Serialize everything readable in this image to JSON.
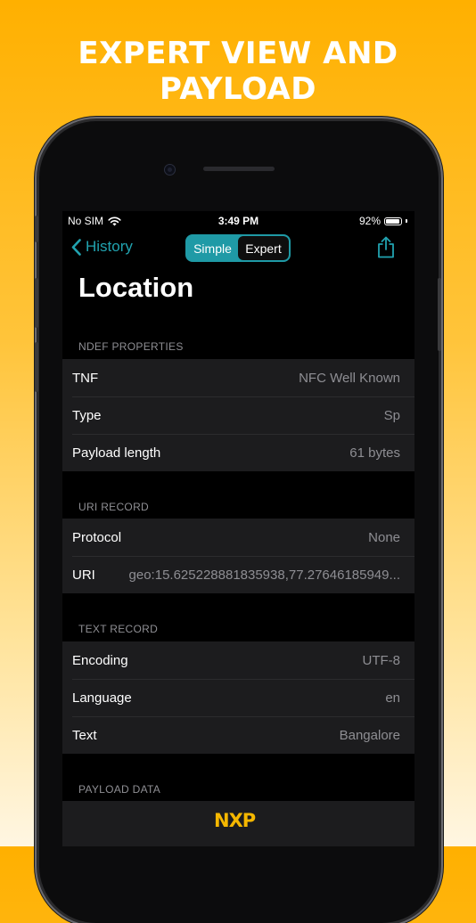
{
  "headline": "EXPERT VIEW AND PAYLOAD",
  "status": {
    "carrier": "No SIM",
    "time": "3:49 PM",
    "battery": "92%",
    "battery_level": 0.92
  },
  "nav": {
    "back_label": "History",
    "segments": [
      "Simple",
      "Expert"
    ],
    "selected_segment": "Expert",
    "share_icon": "share-icon"
  },
  "page_title": "Location",
  "sections": [
    {
      "header": "NDEF PROPERTIES",
      "rows": [
        {
          "label": "TNF",
          "value": "NFC Well Known"
        },
        {
          "label": "Type",
          "value": "Sp"
        },
        {
          "label": "Payload length",
          "value": "61 bytes"
        }
      ]
    },
    {
      "header": "URI RECORD",
      "rows": [
        {
          "label": "Protocol",
          "value": "None"
        },
        {
          "label": "URI",
          "value": "geo:15.625228881835938,77.27646185949..."
        }
      ]
    },
    {
      "header": "TEXT RECORD",
      "rows": [
        {
          "label": "Encoding",
          "value": "UTF-8"
        },
        {
          "label": "Language",
          "value": "en"
        },
        {
          "label": "Text",
          "value": "Bangalore"
        }
      ]
    },
    {
      "header": "PAYLOAD DATA",
      "rows": []
    }
  ],
  "footer": {
    "logo": "NXP"
  },
  "colors": {
    "accent": "#1f9aa6",
    "brand_logo": "#f5b700",
    "background_top": "#ffb000"
  }
}
